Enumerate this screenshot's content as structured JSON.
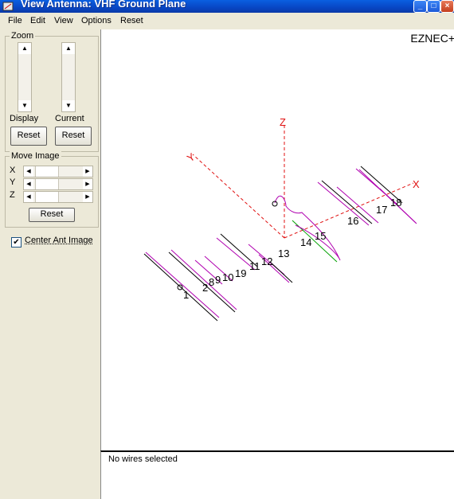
{
  "window": {
    "title": "View Antenna: VHF Ground Plane"
  },
  "menu": [
    "File",
    "Edit",
    "View",
    "Options",
    "Reset"
  ],
  "zoom": {
    "group_label": "Zoom",
    "display_label": "Display",
    "current_label": "Current",
    "reset_label": "Reset"
  },
  "move_image": {
    "group_label": "Move Image",
    "axes": [
      "X",
      "Y",
      "Z"
    ],
    "reset_label": "Reset"
  },
  "center_ant_image": {
    "label": "Center Ant Image",
    "checked": true
  },
  "canvas": {
    "brand": "EZNEC+",
    "axis_labels": {
      "z": "Z",
      "y": "Y",
      "x": "X"
    },
    "wire_labels": [
      "1",
      "2",
      "8",
      "9",
      "10",
      "19",
      "11",
      "12",
      "13",
      "14",
      "15",
      "16",
      "17",
      "18"
    ]
  },
  "status": {
    "text": "No wires selected"
  },
  "colors": {
    "title_bar": "#0846c4",
    "axis": "#e01010",
    "wire": "#000000",
    "current": "#b000b0",
    "feed_green": "#00a000"
  }
}
